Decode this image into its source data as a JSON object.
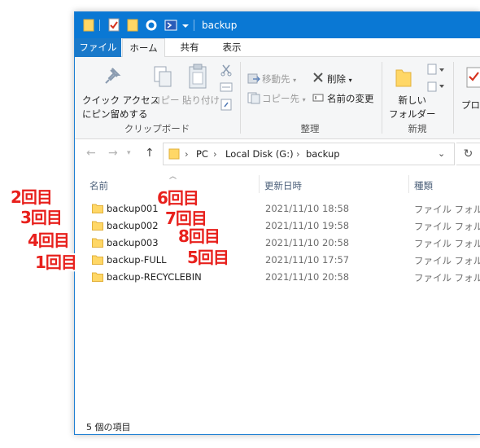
{
  "window": {
    "title": "backup",
    "accent_color": "#0a78d4"
  },
  "tabs": {
    "file": "ファイル",
    "home": "ホーム",
    "share": "共有",
    "view": "表示"
  },
  "ribbon": {
    "pin_line1": "クイック アクセス",
    "pin_line2": "にピン留めする",
    "copy": "コピー",
    "paste": "貼り付け",
    "clipboard_group": "クリップボード",
    "move_to": "移動先",
    "copy_to": "コピー先",
    "delete": "削除",
    "rename": "名前の変更",
    "organize_group": "整理",
    "new_folder_line1": "新しい",
    "new_folder_line2": "フォルダー",
    "new_group": "新規",
    "properties": "プロパ"
  },
  "address": {
    "seg_pc": "PC",
    "seg_disk": "Local Disk (G:)",
    "seg_folder": "backup"
  },
  "columns": {
    "name": "名前",
    "modified": "更新日時",
    "type": "種類"
  },
  "files": [
    {
      "name": "backup001",
      "date": "2021/11/10 18:58",
      "type": "ファイル フォルダー"
    },
    {
      "name": "backup002",
      "date": "2021/11/10 19:58",
      "type": "ファイル フォルダー"
    },
    {
      "name": "backup003",
      "date": "2021/11/10 20:58",
      "type": "ファイル フォルダー"
    },
    {
      "name": "backup-FULL",
      "date": "2021/11/10 17:57",
      "type": "ファイル フォルダー"
    },
    {
      "name": "backup-RECYCLEBIN",
      "date": "2021/11/10 20:58",
      "type": "ファイル フォルダー"
    }
  ],
  "status": "5 個の項目",
  "annotations": {
    "left": [
      "2回目",
      "3回目",
      "4回目",
      "1回目"
    ],
    "right": [
      "6回目",
      "7回目",
      "8回目",
      "5回目"
    ],
    "color": "#e8201c"
  }
}
